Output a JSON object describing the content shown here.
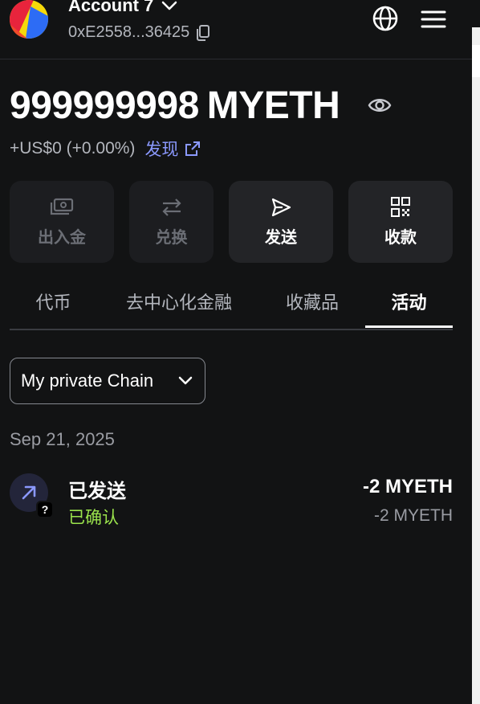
{
  "header": {
    "account_name": "Account 7",
    "address": "0xE2558...36425"
  },
  "balance": {
    "amount": "999999998",
    "unit": "MYETH",
    "fiat_change": "+US$0 (+0.00%)",
    "discover_label": "发现"
  },
  "actions": [
    {
      "label": "出入金",
      "icon": "bank-card-icon",
      "enabled": false
    },
    {
      "label": "兑换",
      "icon": "swap-icon",
      "enabled": false
    },
    {
      "label": "发送",
      "icon": "send-icon",
      "enabled": true
    },
    {
      "label": "收款",
      "icon": "qr-code-icon",
      "enabled": true
    }
  ],
  "tabs": [
    {
      "label": "代币",
      "active": false
    },
    {
      "label": "去中心化金融",
      "active": false
    },
    {
      "label": "收藏品",
      "active": false
    },
    {
      "label": "活动",
      "active": true
    }
  ],
  "network_selector": {
    "value": "My private Chain"
  },
  "activity": {
    "date": "Sep 21, 2025",
    "items": [
      {
        "title": "已发送",
        "status": "已确认",
        "amount": "-2 MYETH",
        "amount_secondary": "-2 MYETH",
        "badge": "?"
      }
    ]
  },
  "colors": {
    "background": "#121314",
    "accent_link": "#8b99ff",
    "success": "#9ae34c"
  }
}
